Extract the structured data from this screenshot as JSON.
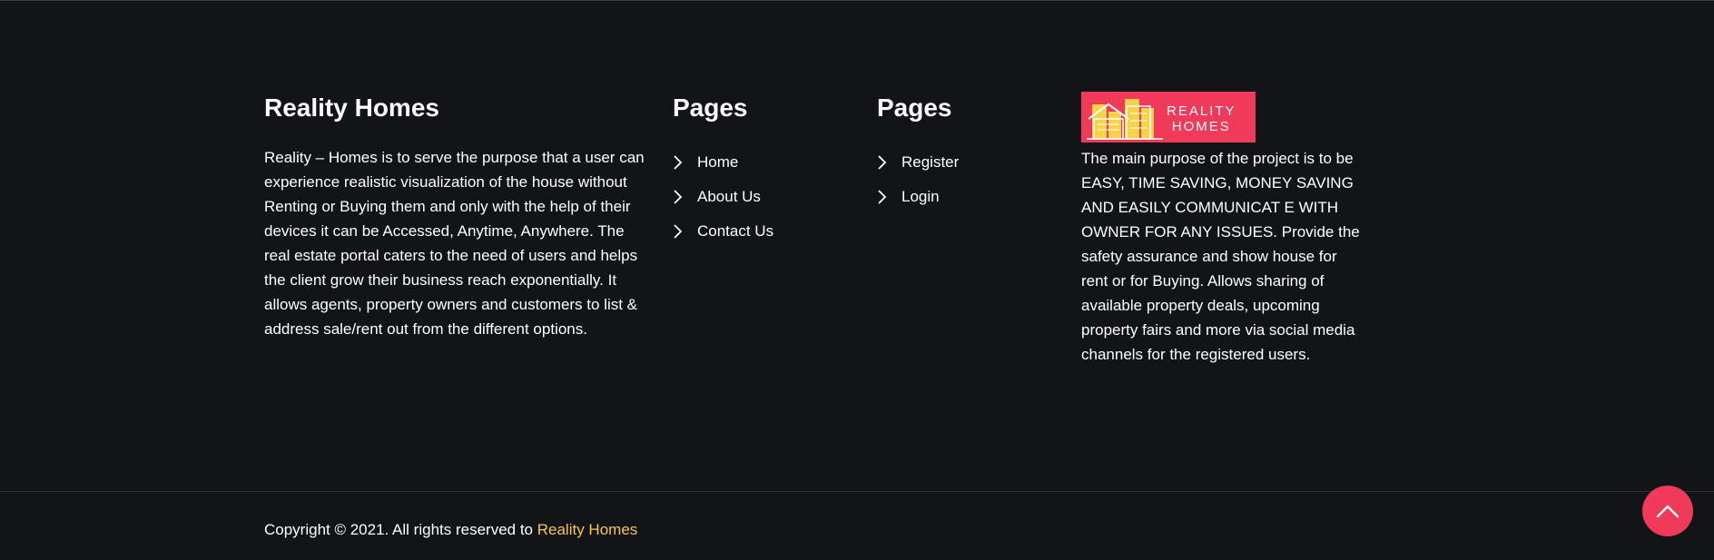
{
  "about": {
    "title": "Reality Homes",
    "text": "Reality – Homes is to serve the purpose that a user can experience realistic visualization of the house without Renting or Buying them and only with the help of their devices it can be Accessed, Anytime, Anywhere. The real estate portal caters to the need of users and helps the client grow their business reach exponentially. It allows agents, property owners and customers to list & address sale/rent out from the different options."
  },
  "pages1": {
    "title": "Pages",
    "links": [
      "Home",
      "About Us",
      "Contact Us"
    ]
  },
  "pages2": {
    "title": "Pages",
    "links": [
      "Register",
      "Login"
    ]
  },
  "logo": {
    "line1": "REALITY",
    "line2": "HOMES",
    "description": "The main purpose of the project is to be EASY, TIME SAVING, MONEY SAVING AND EASILY COMMUNICAT E WITH OWNER FOR ANY ISSUES. Provide the safety assurance and show house for rent or for Buying. Allows sharing of available property deals, upcoming property fairs and more via social media channels for the registered users."
  },
  "copyright": {
    "prefix": "Copyright © 2021. All rights reserved to ",
    "brand": "Reality Homes"
  },
  "colors": {
    "background": "#131417",
    "accent": "#f1395a",
    "brand_link": "#f9c74f"
  },
  "icons": {
    "link_bullet": "chevron-right-icon",
    "scroll_top": "chevron-up-icon"
  }
}
